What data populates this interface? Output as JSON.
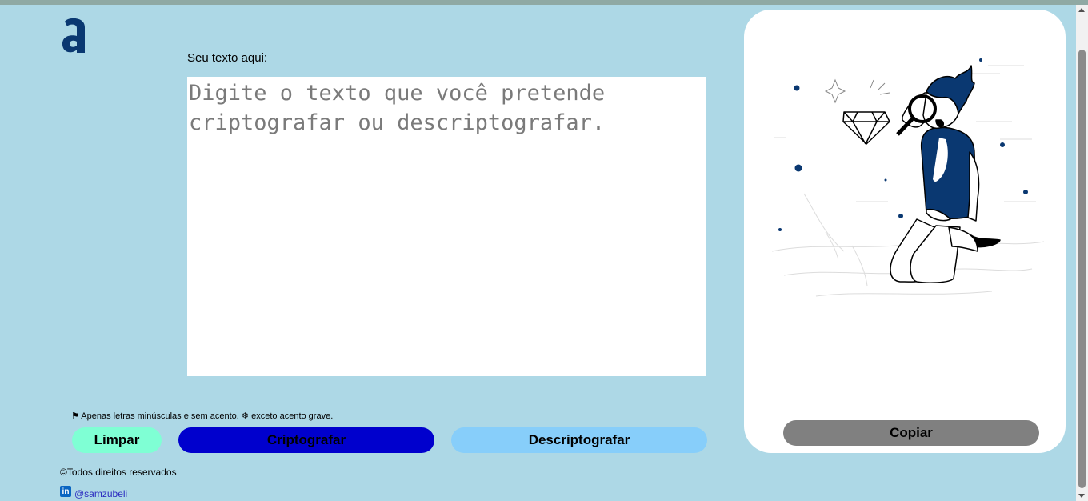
{
  "logo": {
    "icon": "alura-logo-icon",
    "color": "#0a3871"
  },
  "editor": {
    "label": "Seu texto aqui:",
    "value": "",
    "placeholder": "Digite o texto que você pretende criptografar ou descriptografar."
  },
  "warning": "⚑ Apenas letras minúsculas e sem acento. ❄ exceto acento grave.",
  "buttons": {
    "clear": "Limpar",
    "encrypt": "Criptografar",
    "decrypt": "Descriptografar",
    "copy": "Copiar"
  },
  "footer": {
    "copyright": "©Todos direitos reservados",
    "linkedin_icon": "linkedin-icon",
    "linkedin_glyph": "in",
    "linkedin_handle": "@samzubeli"
  },
  "output": {
    "illustration": "person-magnifier-diamond-illustration"
  },
  "colors": {
    "background": "#add8e6",
    "clear_button": "#7fffd4",
    "encrypt_button": "#0000cd",
    "decrypt_button": "#87cefa",
    "copy_button": "#808080",
    "brand_dark_blue": "#0a3871"
  }
}
